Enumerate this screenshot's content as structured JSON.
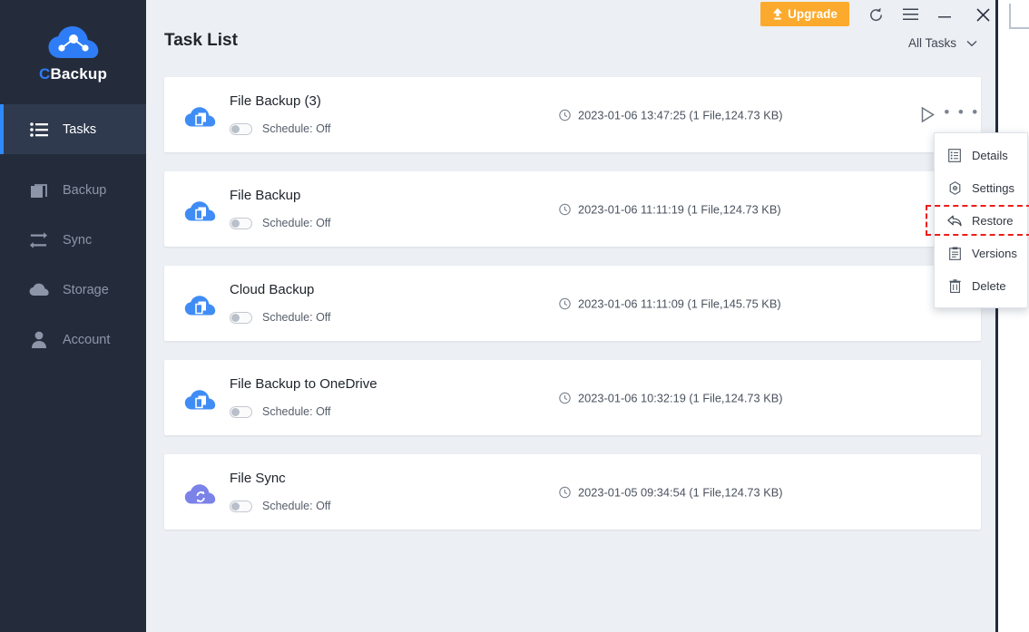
{
  "app": {
    "logo_c": "C",
    "logo_rest": "Backup"
  },
  "sidebar": {
    "items": [
      {
        "label": "Tasks",
        "icon": "list-icon",
        "active": true
      },
      {
        "label": "Backup",
        "icon": "backup-icon",
        "active": false
      },
      {
        "label": "Sync",
        "icon": "sync-icon",
        "active": false
      },
      {
        "label": "Storage",
        "icon": "cloud-icon",
        "active": false
      },
      {
        "label": "Account",
        "icon": "person-icon",
        "active": false
      }
    ]
  },
  "titlebar": {
    "upgrade_label": "Upgrade",
    "upgrade_color": "#fcaa2d",
    "refresh_icon": "refresh-icon",
    "menu_icon": "hamburger-menu-icon",
    "minimize_icon": "minimize-icon",
    "close_icon": "close-icon"
  },
  "header": {
    "title": "Task List",
    "filter_value": "All Tasks",
    "filter_chevron": "chevron-down-icon"
  },
  "tasks": [
    {
      "name": "File Backup (3)",
      "schedule": "Schedule: Off",
      "schedule_on": false,
      "timestamp": "2023-01-06 13:47:25 (1 File,124.73 KB)",
      "icon": "cloud-backup-icon",
      "icon_color": "#3f8cf5"
    },
    {
      "name": "File Backup",
      "schedule": "Schedule: Off",
      "schedule_on": false,
      "timestamp": "2023-01-06 11:11:19 (1 File,124.73 KB)",
      "icon": "cloud-backup-icon",
      "icon_color": "#3f8cf5"
    },
    {
      "name": "Cloud Backup",
      "schedule": "Schedule: Off",
      "schedule_on": false,
      "timestamp": "2023-01-06 11:11:09 (1 File,145.75 KB)",
      "icon": "cloud-backup-icon",
      "icon_color": "#3f8cf5"
    },
    {
      "name": "File Backup to OneDrive",
      "schedule": "Schedule: Off",
      "schedule_on": false,
      "timestamp": "2023-01-06 10:32:19 (1 File,124.73 KB)",
      "icon": "cloud-backup-icon",
      "icon_color": "#3f8cf5"
    },
    {
      "name": "File Sync",
      "schedule": "Schedule: Off",
      "schedule_on": false,
      "timestamp": "2023-01-05 09:34:54 (1 File,124.73 KB)",
      "icon": "cloud-sync-icon",
      "icon_color": "#7b82e8"
    }
  ],
  "row_actions": {
    "run_icon": "play-icon",
    "more_icon": "ellipsis-icon",
    "more_glyph": "• • •"
  },
  "context_menu": {
    "highlight_color": "#ee1c1c",
    "items": [
      {
        "label": "Details",
        "icon": "details-icon",
        "highlighted": false
      },
      {
        "label": "Settings",
        "icon": "settings-gear-icon",
        "highlighted": false
      },
      {
        "label": "Restore",
        "icon": "restore-arrow-icon",
        "highlighted": true
      },
      {
        "label": "Versions",
        "icon": "versions-clipboard-icon",
        "highlighted": false
      },
      {
        "label": "Delete",
        "icon": "trash-icon",
        "highlighted": false
      }
    ]
  }
}
